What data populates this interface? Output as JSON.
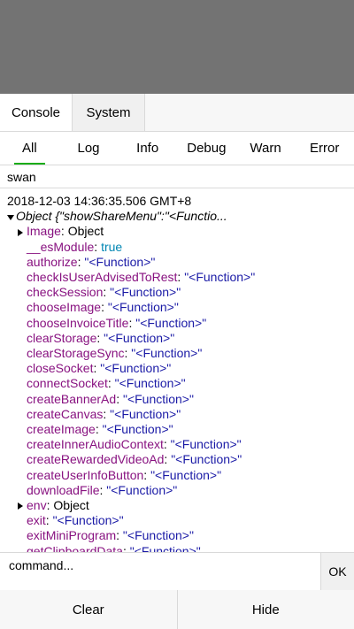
{
  "top_tabs": [
    {
      "label": "Console",
      "active": true
    },
    {
      "label": "System",
      "active": false
    }
  ],
  "filter_tabs": [
    {
      "label": "All",
      "active": true
    },
    {
      "label": "Log"
    },
    {
      "label": "Info"
    },
    {
      "label": "Debug"
    },
    {
      "label": "Warn"
    },
    {
      "label": "Error"
    }
  ],
  "filter_value": "swan",
  "log": {
    "timestamp": "2018-12-03 14:36:35.506 GMT+8",
    "object_header": "Object {\"showShareMenu\":\"<Functio...",
    "entries": [
      {
        "key": "Image",
        "value": "Object",
        "kind": "object"
      },
      {
        "key": "__esModule",
        "value": "true",
        "kind": "bool"
      },
      {
        "key": "authorize",
        "value": "\"<Function>\"",
        "kind": "str"
      },
      {
        "key": "checkIsUserAdvisedToRest",
        "value": "\"<Function>\"",
        "kind": "str"
      },
      {
        "key": "checkSession",
        "value": "\"<Function>\"",
        "kind": "str"
      },
      {
        "key": "chooseImage",
        "value": "\"<Function>\"",
        "kind": "str"
      },
      {
        "key": "chooseInvoiceTitle",
        "value": "\"<Function>\"",
        "kind": "str"
      },
      {
        "key": "clearStorage",
        "value": "\"<Function>\"",
        "kind": "str"
      },
      {
        "key": "clearStorageSync",
        "value": "\"<Function>\"",
        "kind": "str"
      },
      {
        "key": "closeSocket",
        "value": "\"<Function>\"",
        "kind": "str"
      },
      {
        "key": "connectSocket",
        "value": "\"<Function>\"",
        "kind": "str"
      },
      {
        "key": "createBannerAd",
        "value": "\"<Function>\"",
        "kind": "str"
      },
      {
        "key": "createCanvas",
        "value": "\"<Function>\"",
        "kind": "str"
      },
      {
        "key": "createImage",
        "value": "\"<Function>\"",
        "kind": "str"
      },
      {
        "key": "createInnerAudioContext",
        "value": "\"<Function>\"",
        "kind": "str"
      },
      {
        "key": "createRewardedVideoAd",
        "value": "\"<Function>\"",
        "kind": "str"
      },
      {
        "key": "createUserInfoButton",
        "value": "\"<Function>\"",
        "kind": "str"
      },
      {
        "key": "downloadFile",
        "value": "\"<Function>\"",
        "kind": "str"
      },
      {
        "key": "env",
        "value": "Object",
        "kind": "object"
      },
      {
        "key": "exit",
        "value": "\"<Function>\"",
        "kind": "str"
      },
      {
        "key": "exitMiniProgram",
        "value": "\"<Function>\"",
        "kind": "str"
      },
      {
        "key": "getClipboardData",
        "value": "\"<Function>\"",
        "kind": "str"
      }
    ]
  },
  "command": {
    "placeholder": "command...",
    "ok_label": "OK"
  },
  "bottom": {
    "clear_label": "Clear",
    "hide_label": "Hide"
  }
}
